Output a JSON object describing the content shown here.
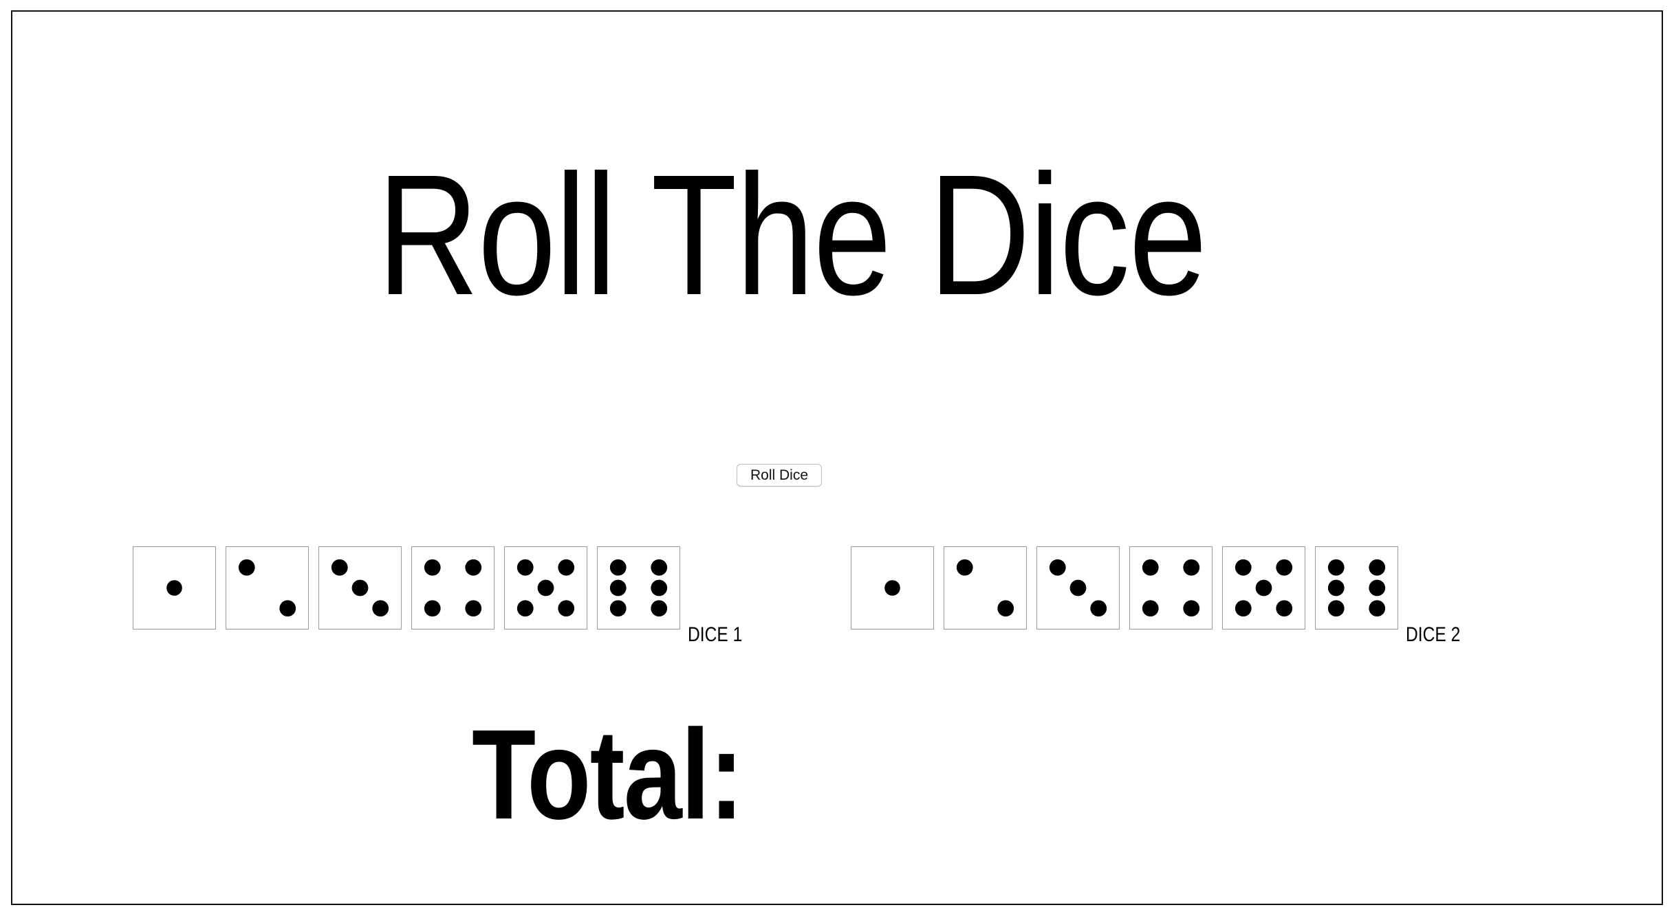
{
  "app": {
    "title": "Roll The Dice",
    "roll_button_label": "Roll Dice",
    "total_label": "Total:"
  },
  "dice_groups": [
    {
      "label": "DICE 1",
      "faces": [
        1,
        2,
        3,
        4,
        5,
        6
      ]
    },
    {
      "label": "DICE 2",
      "faces": [
        1,
        2,
        3,
        4,
        5,
        6
      ]
    }
  ],
  "icons": {
    "die_face": "die-face-icon"
  },
  "colors": {
    "text": "#000000",
    "pip": "#000000",
    "die_border": "#9a9a9a",
    "frame_border": "#111111",
    "background": "#ffffff"
  }
}
